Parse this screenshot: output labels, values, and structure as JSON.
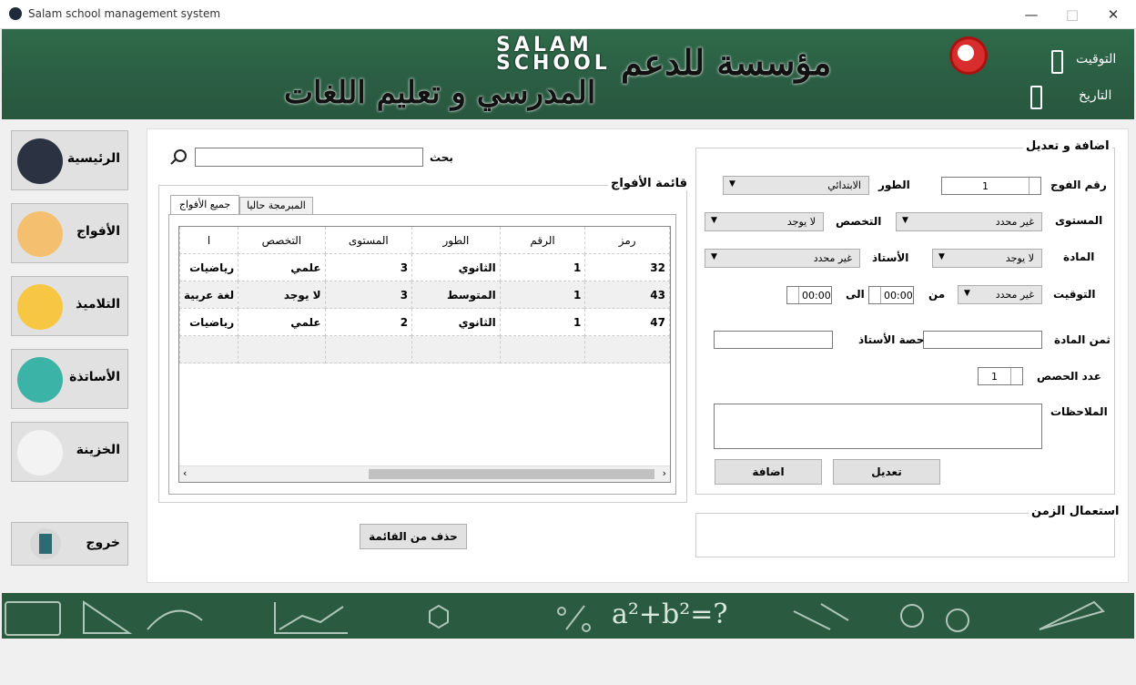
{
  "window": {
    "title": "Salam school management system"
  },
  "banner": {
    "school_top": "SALAM",
    "school_bottom": "SCHOOL",
    "title_line1": "مؤسسة للدعم",
    "title_line2": "المدرسي و تعليم اللغات",
    "time_label": "التوقيت",
    "date_label": "التاريخ"
  },
  "sidebar": {
    "items": [
      {
        "label": "الرئيسية",
        "icon": "salam-logo-icon"
      },
      {
        "label": "الأفواج",
        "icon": "groups-icon"
      },
      {
        "label": "التلاميذ",
        "icon": "student-icon"
      },
      {
        "label": "الأساتذة",
        "icon": "teacher-icon"
      },
      {
        "label": "الخزينة",
        "icon": "cash-register-icon"
      }
    ],
    "exit_label": "خروج"
  },
  "search": {
    "label": "بحث",
    "value": ""
  },
  "groups_list": {
    "title": "قائمة الأفواج",
    "tabs": [
      "جميع الأفواج",
      "المبرمجة حاليا"
    ],
    "columns": [
      "رمز",
      "الرقم",
      "الطور",
      "المستوى",
      "التخصص",
      "ا"
    ],
    "rows": [
      [
        "32",
        "1",
        "الثانوي",
        "3",
        "علمي",
        "رياضيات"
      ],
      [
        "43",
        "1",
        "المتوسط",
        "3",
        "لا يوجد",
        "لغة عربية"
      ],
      [
        "47",
        "1",
        "الثانوي",
        "2",
        "علمي",
        "رياضيات"
      ]
    ],
    "delete_label": "حذف من القائمة"
  },
  "form": {
    "title": "اضافة و تعديل",
    "group_number_label": "رقم الفوج",
    "group_number": "1",
    "stage_label": "الطور",
    "stage_value": "الابتدائي",
    "level_label": "المستوى",
    "level_value": "غير محدد",
    "specialty_label": "التخصص",
    "specialty_value": "لا يوجد",
    "subject_label": "المادة",
    "subject_value": "لا يوجد",
    "teacher_label": "الأستاذ",
    "teacher_value": "غير محدد",
    "timing_label": "التوقيت",
    "day_value": "غير محدد",
    "from_label": "من",
    "from_time": "00:00",
    "to_label": "الى",
    "to_time": "00:00",
    "price_label": "ثمن المادة",
    "price_value": "",
    "teacher_share_label": "حصة الأستاذ",
    "teacher_share_value": "",
    "sessions_label": "عدد الحصص",
    "sessions_value": "1",
    "notes_label": "الملاحظات",
    "notes_value": "",
    "edit_label": "تعديل",
    "add_label": "اضافة"
  },
  "schedule": {
    "title": "استعمال الزمن"
  },
  "colors": {
    "banner": "#2b5f44",
    "accent": "#d72d2d"
  }
}
